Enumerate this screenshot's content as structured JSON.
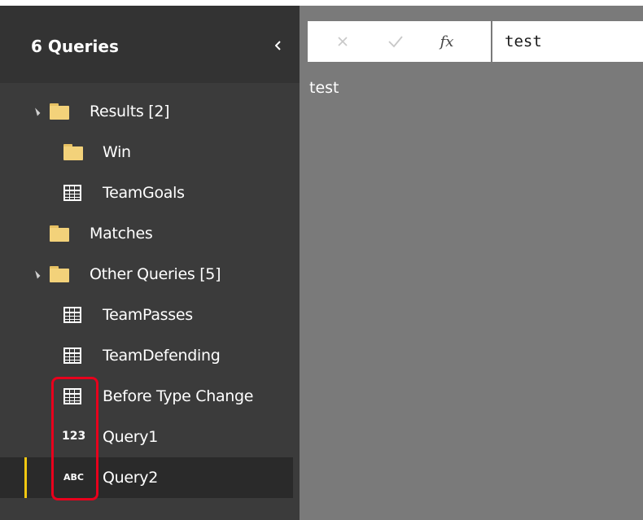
{
  "queries_pane": {
    "title": "6 Queries",
    "collapse_icon": "chevron-left-icon",
    "items": [
      {
        "label": "Results [2]",
        "icon": "folder-icon",
        "expanded": true
      },
      {
        "label": "Win",
        "icon": "folder-icon"
      },
      {
        "label": "TeamGoals",
        "icon": "table-icon"
      },
      {
        "label": "Matches",
        "icon": "folder-icon"
      },
      {
        "label": "Other Queries [5]",
        "icon": "folder-icon",
        "expanded": true
      },
      {
        "label": "TeamPasses",
        "icon": "table-icon"
      },
      {
        "label": "TeamDefending",
        "icon": "table-icon"
      },
      {
        "label": "Before Type Change",
        "icon": "table-icon"
      },
      {
        "label": "Query1",
        "icon": "number-type-icon",
        "icon_text": "123"
      },
      {
        "label": "Query2",
        "icon": "text-type-icon",
        "icon_text": "ABC",
        "selected": true
      }
    ]
  },
  "formula_bar": {
    "cancel_icon": "close-icon",
    "commit_icon": "checkmark-icon",
    "fx_label": "fx",
    "formula_value": "test"
  },
  "result": {
    "value": "test"
  },
  "colors": {
    "pane_background": "#3b3b3b",
    "pane_header": "#333333",
    "content_background": "#7a7a7a",
    "selection_accent": "#f2c811",
    "highlight_border": "#e8001c",
    "folder": "#f3d27a"
  }
}
